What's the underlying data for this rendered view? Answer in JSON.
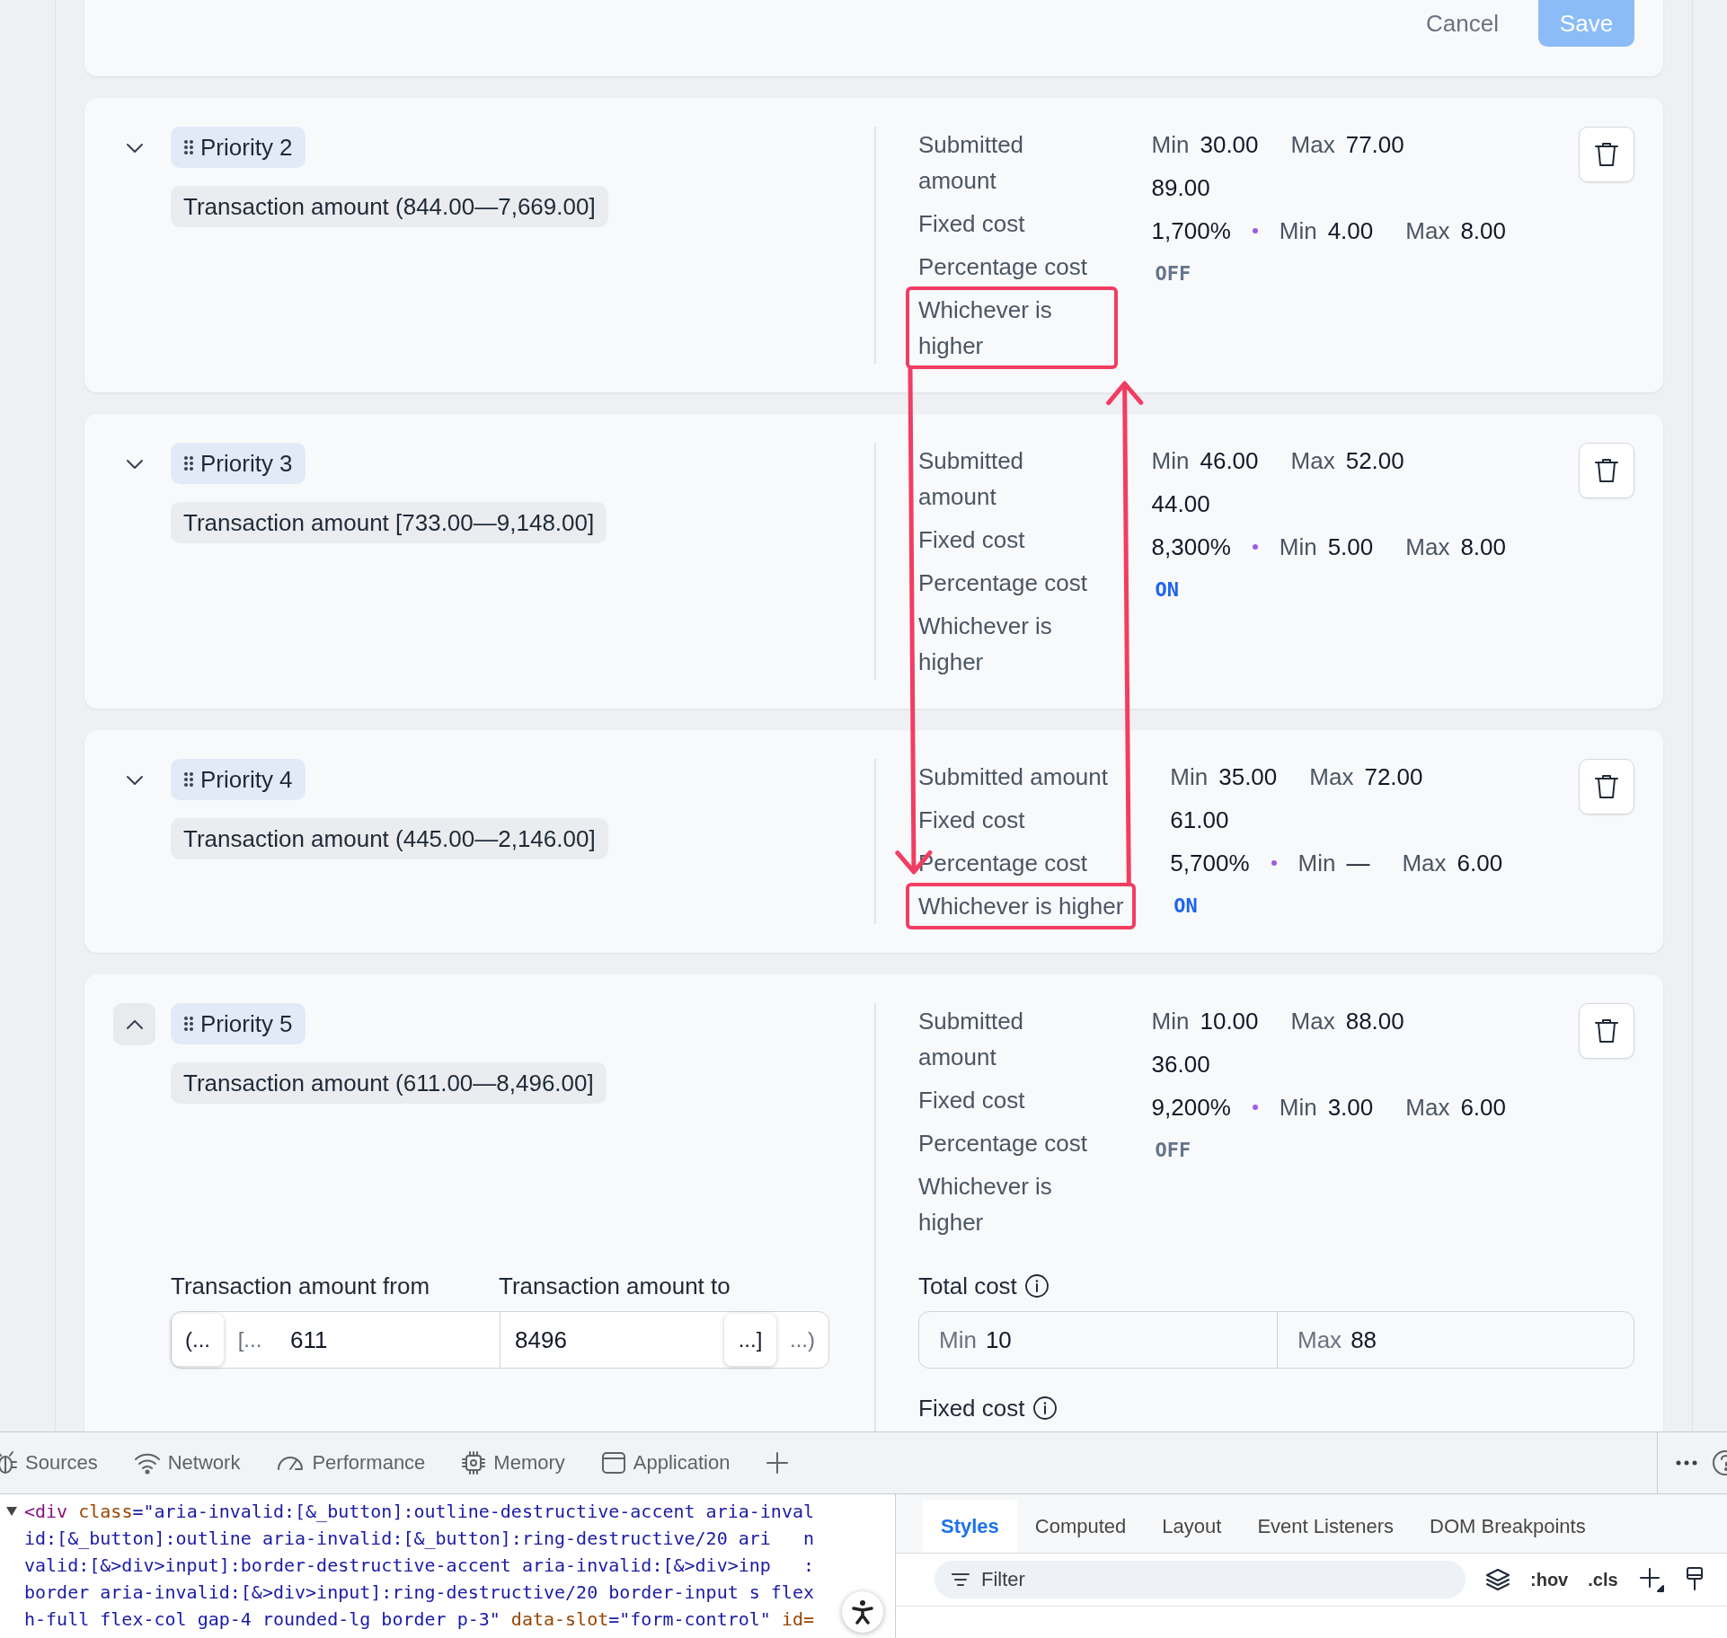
{
  "header": {
    "buttons": [
      {
        "label": "Cancel",
        "kind": "secondary",
        "disabled": false
      },
      {
        "label": "Save",
        "kind": "primary",
        "disabled": true
      }
    ]
  },
  "rules": [
    {
      "priority": "Priority 2",
      "expanded": false,
      "condition": "Transaction amount (844.00—7,669.00]",
      "labels": [
        {
          "text": "Submitted amount",
          "highlighted": false
        },
        {
          "text": "Fixed cost",
          "highlighted": false
        },
        {
          "text": "Percentage cost",
          "highlighted": false
        },
        {
          "text": "Whichever is higher",
          "highlighted": true
        }
      ],
      "submitted": {
        "min_label": "Min",
        "min": "30.00",
        "max_label": "Max",
        "max": "77.00"
      },
      "fixed_cost": "89.00",
      "percentage": {
        "rate": "1,700%",
        "min_label": "Min",
        "min": "4.00",
        "max_label": "Max",
        "max": "8.00"
      },
      "whichever": {
        "text": "OFF",
        "on": false
      }
    },
    {
      "priority": "Priority 3",
      "expanded": false,
      "condition": "Transaction amount [733.00—9,148.00]",
      "labels": [
        {
          "text": "Submitted amount",
          "highlighted": false
        },
        {
          "text": "Fixed cost",
          "highlighted": false
        },
        {
          "text": "Percentage cost",
          "highlighted": false
        },
        {
          "text": "Whichever is higher",
          "highlighted": false
        }
      ],
      "submitted": {
        "min_label": "Min",
        "min": "46.00",
        "max_label": "Max",
        "max": "52.00"
      },
      "fixed_cost": "44.00",
      "percentage": {
        "rate": "8,300%",
        "min_label": "Min",
        "min": "5.00",
        "max_label": "Max",
        "max": "8.00"
      },
      "whichever": {
        "text": "ON",
        "on": true
      }
    },
    {
      "priority": "Priority 4",
      "expanded": false,
      "condition": "Transaction amount (445.00—2,146.00]",
      "labels": [
        {
          "text": "Submitted amount",
          "highlighted": false
        },
        {
          "text": "Fixed cost",
          "highlighted": false
        },
        {
          "text": "Percentage cost",
          "highlighted": false
        },
        {
          "text": "Whichever is higher",
          "highlighted": true
        }
      ],
      "submitted": {
        "min_label": "Min",
        "min": "35.00",
        "max_label": "Max",
        "max": "72.00"
      },
      "fixed_cost": "61.00",
      "percentage": {
        "rate": "5,700%",
        "min_label": "Min",
        "min": "—",
        "max_label": "Max",
        "max": "6.00"
      },
      "whichever": {
        "text": "ON",
        "on": true
      }
    },
    {
      "priority": "Priority 5",
      "expanded": true,
      "condition": "Transaction amount (611.00—8,496.00]",
      "labels": [
        {
          "text": "Submitted amount",
          "highlighted": false
        },
        {
          "text": "Fixed cost",
          "highlighted": false
        },
        {
          "text": "Percentage cost",
          "highlighted": false
        },
        {
          "text": "Whichever is higher",
          "highlighted": false
        }
      ],
      "submitted": {
        "min_label": "Min",
        "min": "10.00",
        "max_label": "Max",
        "max": "88.00"
      },
      "fixed_cost": "36.00",
      "percentage": {
        "rate": "9,200%",
        "min_label": "Min",
        "min": "3.00",
        "max_label": "Max",
        "max": "6.00"
      },
      "whichever": {
        "text": "OFF",
        "on": false
      },
      "details": {
        "range": {
          "from_label": "Transaction amount from",
          "to_label": "Transaction amount to",
          "from": "611",
          "to": "8496",
          "lower_bounds": [
            {
              "text": "(...",
              "selected": true
            },
            {
              "text": "[...",
              "selected": false
            }
          ],
          "upper_bounds": [
            {
              "text": "...]",
              "selected": true
            },
            {
              "text": "...)",
              "selected": false
            }
          ]
        },
        "total_cost": {
          "label": "Total cost",
          "min_label": "Min",
          "min": "10",
          "max_label": "Max",
          "max": "88"
        },
        "fixed_cost": {
          "label": "Fixed cost"
        }
      }
    }
  ],
  "annotation_arrows": true,
  "devtools": {
    "tabs": [
      {
        "label": "Sources",
        "kind": "bug"
      },
      {
        "label": "Network",
        "kind": "wifi"
      },
      {
        "label": "Performance",
        "kind": "gauge"
      },
      {
        "label": "Memory",
        "kind": "chip"
      },
      {
        "label": "Application",
        "kind": "window"
      }
    ],
    "code": {
      "expanded": true,
      "lines": [
        {
          "segments": [
            {
              "kind": "tag",
              "text": "<div"
            },
            {
              "kind": "attr",
              "text": " class"
            },
            {
              "kind": "value",
              "text": "=\"aria-invalid:[&_button]:outline-destructive-accent aria-inval"
            }
          ]
        },
        {
          "segments": [
            {
              "kind": "value",
              "text": "id:[&_button]:outline aria-invalid:[&_button]:ring-destructive/20 ari   n"
            }
          ]
        },
        {
          "segments": [
            {
              "kind": "value",
              "text": "valid:[&>div>input]:border-destructive-accent aria-invalid:[&>div>inp   :"
            }
          ]
        },
        {
          "segments": [
            {
              "kind": "value",
              "text": "border aria-invalid:[&>div>input]:ring-destructive/20 border-input s flex"
            }
          ]
        },
        {
          "segments": [
            {
              "kind": "value",
              "text": "h-full flex-col gap-4 rounded-lg border p-3\""
            },
            {
              "kind": "attr",
              "text": " data-slot"
            },
            {
              "kind": "value",
              "text": "=\"form-control\""
            },
            {
              "kind": "attr",
              "text": " id="
            }
          ]
        }
      ]
    },
    "panel_tabs": [
      {
        "label": "Styles",
        "selected": true
      },
      {
        "label": "Computed",
        "selected": false
      },
      {
        "label": "Layout",
        "selected": false
      },
      {
        "label": "Event Listeners",
        "selected": false
      },
      {
        "label": "DOM Breakpoints",
        "selected": false
      }
    ],
    "filter": {
      "placeholder": "Filter"
    },
    "toggles": [
      ":hov",
      ".cls"
    ]
  }
}
